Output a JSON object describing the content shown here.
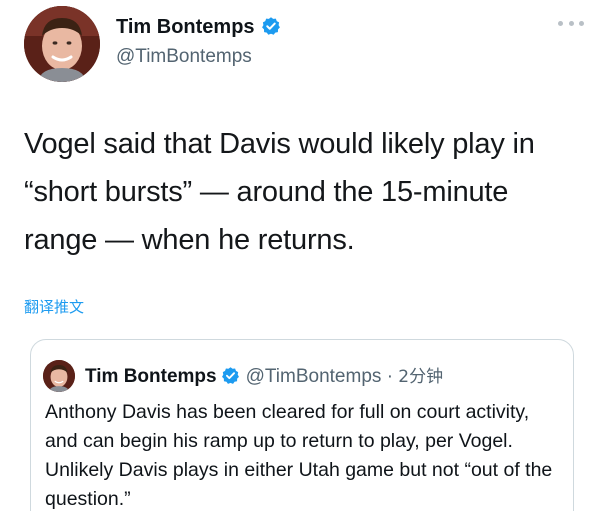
{
  "tweet": {
    "display_name": "Tim Bontemps",
    "handle": "@TimBontemps",
    "text": "Vogel said that Davis would likely play in “short bursts” — around the 15-minute range — when he returns.",
    "translate_label": "翻译推文",
    "more_icon": "more-options-icon",
    "verified_icon": "verified-badge-icon"
  },
  "quoted_tweet": {
    "display_name": "Tim Bontemps",
    "handle": "@TimBontemps",
    "separator": "·",
    "time": "2分钟",
    "text": "Anthony Davis has been cleared for full on court activity, and can begin his ramp up to return to play, per Vogel. Unlikely Davis plays in either Utah game but not “out of the question.”"
  },
  "colors": {
    "verified_blue": "#1d9bf0",
    "link_blue": "#1d9bf0",
    "secondary_text": "#536471",
    "border": "#cfd9de"
  }
}
